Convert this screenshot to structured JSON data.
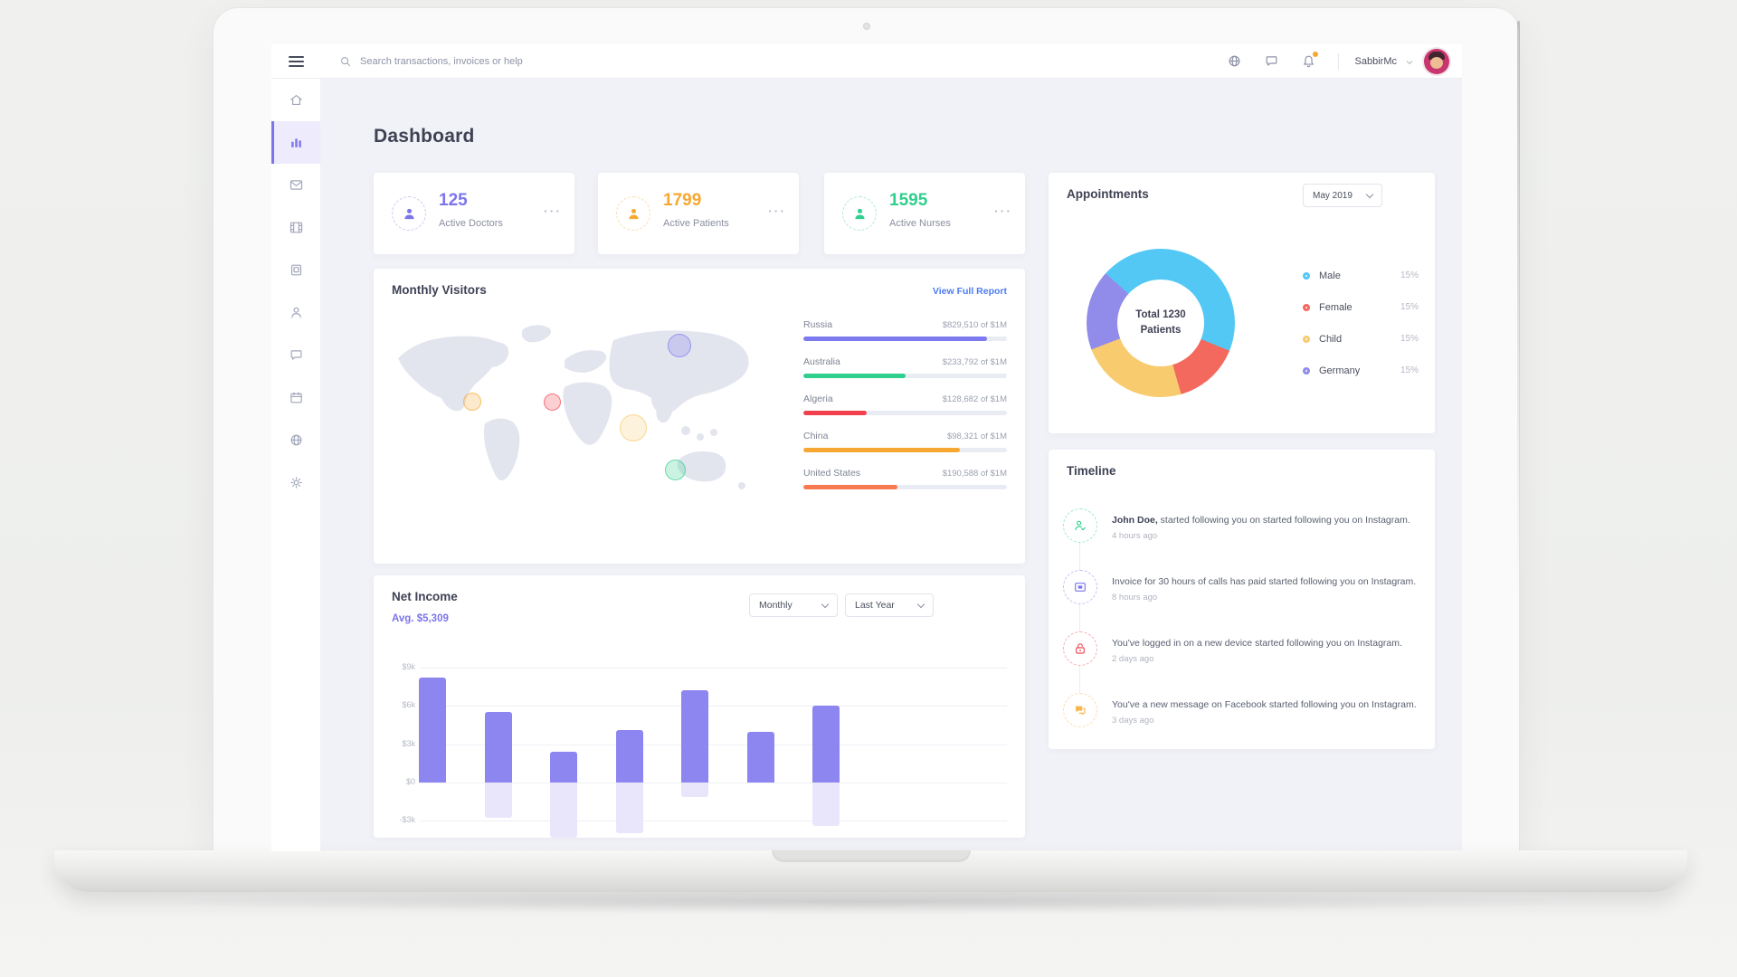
{
  "ui": {
    "ellipsis": "···"
  },
  "topbar": {
    "search_placeholder": "Search transactions, invoices or help",
    "user_name": "SabbirMc"
  },
  "sidebar": {
    "items": [
      {
        "name": "home",
        "active": false
      },
      {
        "name": "bar-chart",
        "active": true
      },
      {
        "name": "mail",
        "active": false
      },
      {
        "name": "film",
        "active": false
      },
      {
        "name": "tablet",
        "active": false
      },
      {
        "name": "user",
        "active": false
      },
      {
        "name": "chat",
        "active": false
      },
      {
        "name": "calendar",
        "active": false
      },
      {
        "name": "globe",
        "active": false
      },
      {
        "name": "settings",
        "active": false
      }
    ]
  },
  "page_title": "Dashboard",
  "stats": [
    {
      "value": "125",
      "label": "Active Doctors",
      "color": "#7c75ea"
    },
    {
      "value": "1799",
      "label": "Active Patients",
      "color": "#f7a832"
    },
    {
      "value": "1595",
      "label": "Active Nurses",
      "color": "#2fcf8d"
    }
  ],
  "monthly_visitors": {
    "title": "Monthly Visitors",
    "link_label": "View Full Report",
    "chart_data": {
      "type": "bar",
      "orientation": "horizontal-progress",
      "categories": [
        "Russia",
        "Australia",
        "Algeria",
        "China",
        "United States"
      ],
      "values_text": [
        "$829,510 of $1M",
        "$233,792 of $1M",
        "$128,682 of $1M",
        "$98,321 of $1M",
        "$190,588 of $1M"
      ],
      "percent": [
        90,
        50,
        31,
        77,
        46
      ],
      "colors": [
        "#7d79ee",
        "#2fcf8d",
        "#f2414e",
        "#f7a832",
        "#f8784f"
      ]
    },
    "map_markers": [
      {
        "name": "russia",
        "color": "#7d79ee",
        "x": 76,
        "y": 15,
        "size": 26
      },
      {
        "name": "north-america",
        "color": "#f7a832",
        "x": 22,
        "y": 43,
        "size": 20
      },
      {
        "name": "west-africa",
        "color": "#f2414e",
        "x": 43,
        "y": 43,
        "size": 19
      },
      {
        "name": "south-asia",
        "color": "#f8cb6e",
        "x": 64,
        "y": 56,
        "size": 30
      },
      {
        "name": "australia",
        "color": "#2fcf8d",
        "x": 75,
        "y": 77,
        "size": 23
      }
    ]
  },
  "appointments": {
    "title": "Appointments",
    "period": "May 2019",
    "center_line1": "Total 1230",
    "center_line2": "Patients",
    "chart_data": {
      "type": "pie",
      "donut": true,
      "center_label": "Total 1230 Patients",
      "start_deg": -48,
      "segments": [
        {
          "label": "Male",
          "color": "#53c8f4",
          "deg": 160,
          "legend_percent": "15%"
        },
        {
          "label": "Female",
          "color": "#f4695e",
          "deg": 52,
          "legend_percent": "15%"
        },
        {
          "label": "Child",
          "color": "#f8cb6e",
          "deg": 85,
          "legend_percent": "15%"
        },
        {
          "label": "Germany",
          "color": "#918bea",
          "deg": 63,
          "legend_percent": "15%"
        }
      ]
    }
  },
  "net_income": {
    "title": "Net Income",
    "avg_label": "Avg. $5,309",
    "dropdowns": [
      "Monthly",
      "Last Year"
    ],
    "chart_data": {
      "type": "bar",
      "y_tick_labels": [
        "$9k",
        "$6k",
        "$3k",
        "$0",
        "-$3k"
      ],
      "y_ticks_k": [
        9,
        6,
        3,
        0,
        -3
      ],
      "values_k": [
        8.2,
        5.5,
        2.4,
        4.1,
        7.2,
        4.0,
        6.0
      ],
      "shadow_k": [
        0,
        2.8,
        4.3,
        4.0,
        1.1,
        0,
        3.4
      ],
      "bar_color": "#8d85f0",
      "shadow_color": "#e9e6fb"
    }
  },
  "timeline": {
    "title": "Timeline",
    "items": [
      {
        "icon": "person-check",
        "color": "#2fcf8d",
        "bold": "John Doe,",
        "text": " started following you on started following you on Instagram.",
        "time": "4 hours ago"
      },
      {
        "icon": "invoice-card",
        "color": "#7c75ea",
        "bold": "",
        "text": "Invoice for 30 hours of calls has paid started following you on Instagram.",
        "time": "8 hours ago"
      },
      {
        "icon": "lock",
        "color": "#ef4b56",
        "bold": "",
        "text": "You've logged in on a new device started following you on Instagram.",
        "time": "2 days ago"
      },
      {
        "icon": "chat-double",
        "color": "#f8b64c",
        "bold": "",
        "text": "You've a new message on Facebook started following you on Instagram.",
        "time": "3 days ago"
      }
    ]
  }
}
